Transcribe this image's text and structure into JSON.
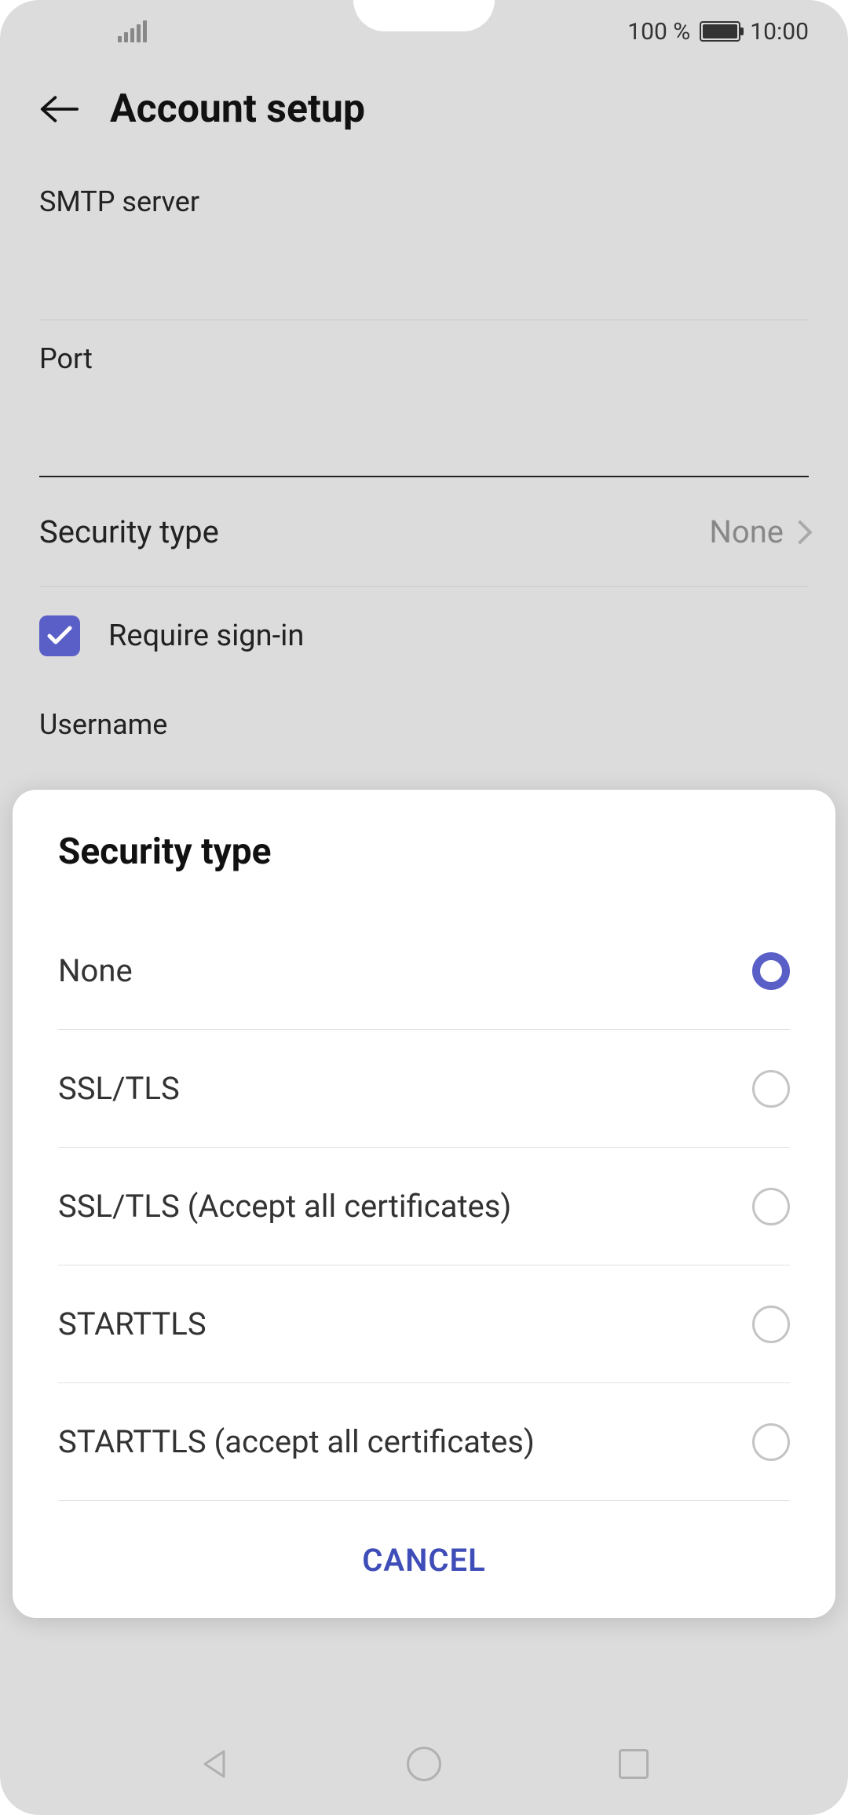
{
  "status": {
    "battery_pct": "100 %",
    "time": "10:00"
  },
  "header": {
    "title": "Account setup"
  },
  "form": {
    "smtp_label": "SMTP server",
    "port_label": "Port",
    "security_label": "Security type",
    "security_value": "None",
    "require_signin_label": "Require sign-in",
    "require_signin_checked": true,
    "username_label": "Username"
  },
  "dialog": {
    "title": "Security type",
    "options": [
      {
        "label": "None",
        "selected": true
      },
      {
        "label": "SSL/TLS",
        "selected": false
      },
      {
        "label": "SSL/TLS (Accept all certificates)",
        "selected": false
      },
      {
        "label": "STARTTLS",
        "selected": false
      },
      {
        "label": "STARTTLS (accept all certificates)",
        "selected": false
      }
    ],
    "cancel": "CANCEL"
  }
}
